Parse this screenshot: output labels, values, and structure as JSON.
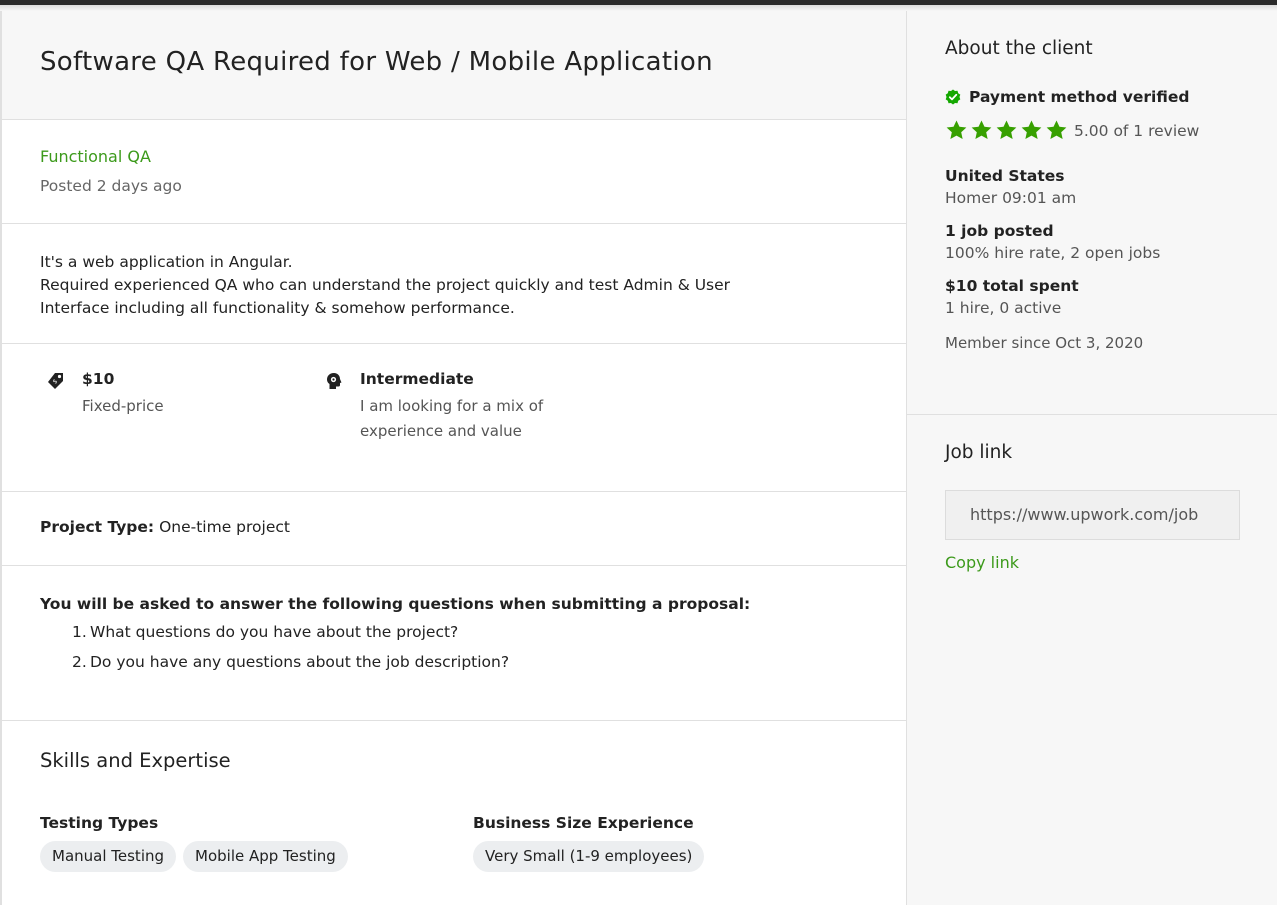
{
  "colors": {
    "accent_green": "#3c9a1b",
    "star_green": "#37a000",
    "panel_bg": "#f7f7f7"
  },
  "job": {
    "title": "Software QA Required for Web / Mobile Application",
    "category": "Functional QA",
    "posted": "Posted 2 days ago",
    "description": [
      "It's a web application in Angular.",
      "Required experienced QA who can understand the project quickly and test Admin & User",
      "Interface including all functionality & somehow performance."
    ],
    "terms": [
      {
        "icon": "price-tag-icon",
        "main": "$10",
        "sub": "Fixed-price"
      },
      {
        "icon": "experience-level-icon",
        "main": "Intermediate",
        "sub": "I am looking for a mix of experience and value"
      }
    ],
    "project_type_label": "Project Type:",
    "project_type_value": "One-time project",
    "questions_title": "You will be asked to answer the following questions when submitting a proposal:",
    "questions": [
      {
        "num": "1.",
        "text": "What questions do you have about the project?"
      },
      {
        "num": "2.",
        "text": "Do you have any questions about the job description?"
      }
    ],
    "skills_title": "Skills and Expertise",
    "skill_groups": [
      {
        "heading": "Testing Types",
        "chips": [
          "Manual Testing",
          "Mobile App Testing"
        ]
      },
      {
        "heading": "Business Size Experience",
        "chips": [
          "Very Small (1-9 employees)"
        ]
      }
    ]
  },
  "client": {
    "heading": "About the client",
    "payment": "Payment method verified",
    "rating_stars": 5,
    "rating_text": "5.00 of 1 review",
    "country": "United States",
    "local_time": "Homer 09:01 am",
    "jobs_posted": "1 job posted",
    "jobs_detail": "100% hire rate, 2 open jobs",
    "spent": "$10 total spent",
    "spent_detail": "1 hire, 0 active",
    "member_since": "Member since Oct 3, 2020"
  },
  "job_link": {
    "heading": "Job link",
    "url": "https://www.upwork.com/job",
    "copy_label": "Copy link"
  }
}
